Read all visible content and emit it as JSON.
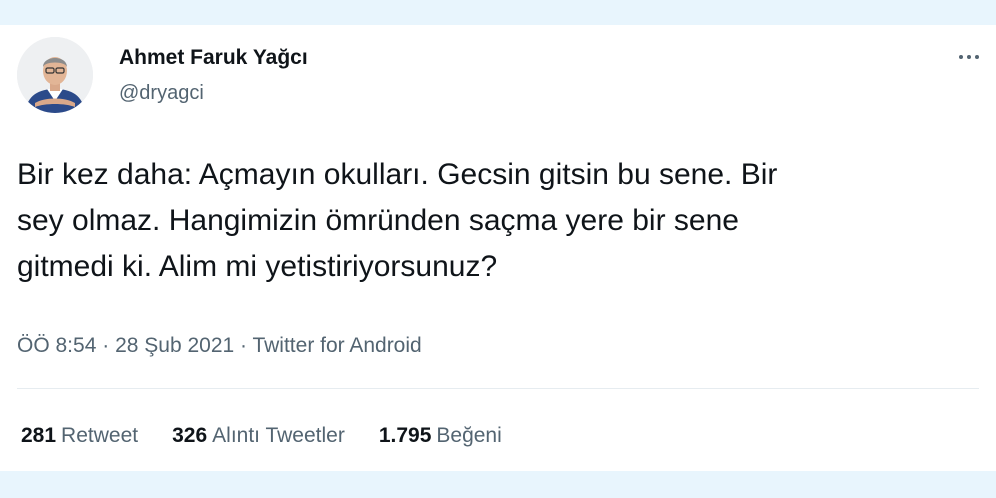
{
  "author": {
    "name": "Ahmet Faruk Yağcı",
    "handle": "@dryagci"
  },
  "tweet": {
    "lines": [
      "Bir kez daha: Açmayın okulları.  Gecsin gitsin bu sene. Bir",
      "sey olmaz.  Hangimizin ömründen saçma yere bir sene",
      "gitmedi ki. Alim mi yetistiriyorsunuz?"
    ]
  },
  "meta": {
    "time": "ÖÖ 8:54",
    "separator1": "·",
    "date": "28 Şub 2021",
    "separator2": "·",
    "source": "Twitter for Android"
  },
  "stats": {
    "retweets": {
      "count": "281",
      "label": "Retweet"
    },
    "quotes": {
      "count": "326",
      "label": "Alıntı Tweetler"
    },
    "likes": {
      "count": "1.795",
      "label": "Beğeni"
    }
  },
  "icons": {
    "more": "more-horizontal-icon"
  },
  "colors": {
    "page_background": "#e8f5fd",
    "card_background": "#ffffff",
    "text_primary": "#0f1419",
    "text_secondary": "#536471"
  }
}
